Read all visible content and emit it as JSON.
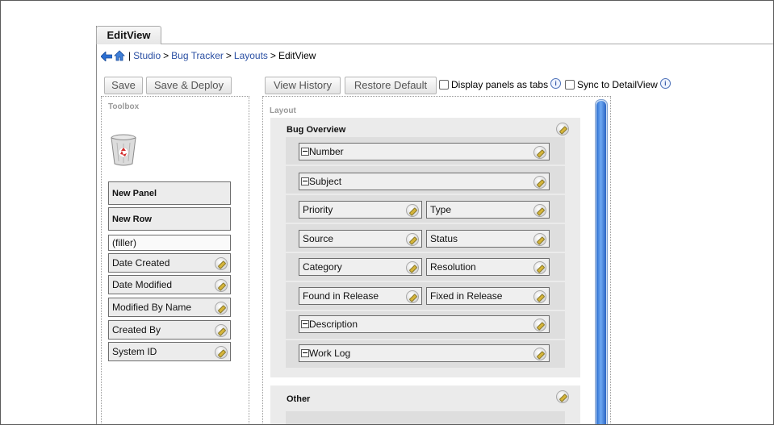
{
  "tab": {
    "label": "EditView"
  },
  "breadcrumb": {
    "items": [
      "Studio",
      "Bug Tracker",
      "Layouts"
    ],
    "current": "EditView",
    "separator": ">",
    "bar": "|"
  },
  "toolbar_left": {
    "save": "Save",
    "save_deploy": "Save & Deploy"
  },
  "toolbar_right": {
    "view_history": "View History",
    "restore_default": "Restore Default",
    "display_panels_as_tabs": "Display panels as tabs",
    "sync_to_detailview": "Sync to DetailView",
    "info_glyph": "i"
  },
  "toolbox": {
    "title": "Toolbox",
    "new_panel": "New Panel",
    "new_row": "New Row",
    "filler": "(filler)",
    "fields": [
      "Date Created",
      "Date Modified",
      "Modified By Name",
      "Created By",
      "System ID"
    ]
  },
  "layout": {
    "title": "Layout",
    "panels": [
      {
        "title": "Bug Overview",
        "full_rows": [
          "Number",
          "Subject"
        ],
        "pair_rows": [
          [
            "Priority",
            "Type"
          ],
          [
            "Source",
            "Status"
          ],
          [
            "Category",
            "Resolution"
          ],
          [
            "Found in Release",
            "Fixed in Release"
          ]
        ],
        "bottom_rows": [
          "Description",
          "Work Log"
        ]
      },
      {
        "title": "Other"
      }
    ]
  },
  "icons": {
    "back": "back-arrow-icon",
    "home": "home-icon",
    "recycle_bin": "recycle-bin-icon",
    "edit": "pencil-icon",
    "info": "info-icon",
    "collapse": "minus-icon"
  },
  "colors": {
    "link": "#2a4fa3",
    "panel_bg": "#ebebeb",
    "row_bg": "#dedede",
    "field_bg": "#efefef",
    "scroll_accent": "#2d6fd0"
  }
}
